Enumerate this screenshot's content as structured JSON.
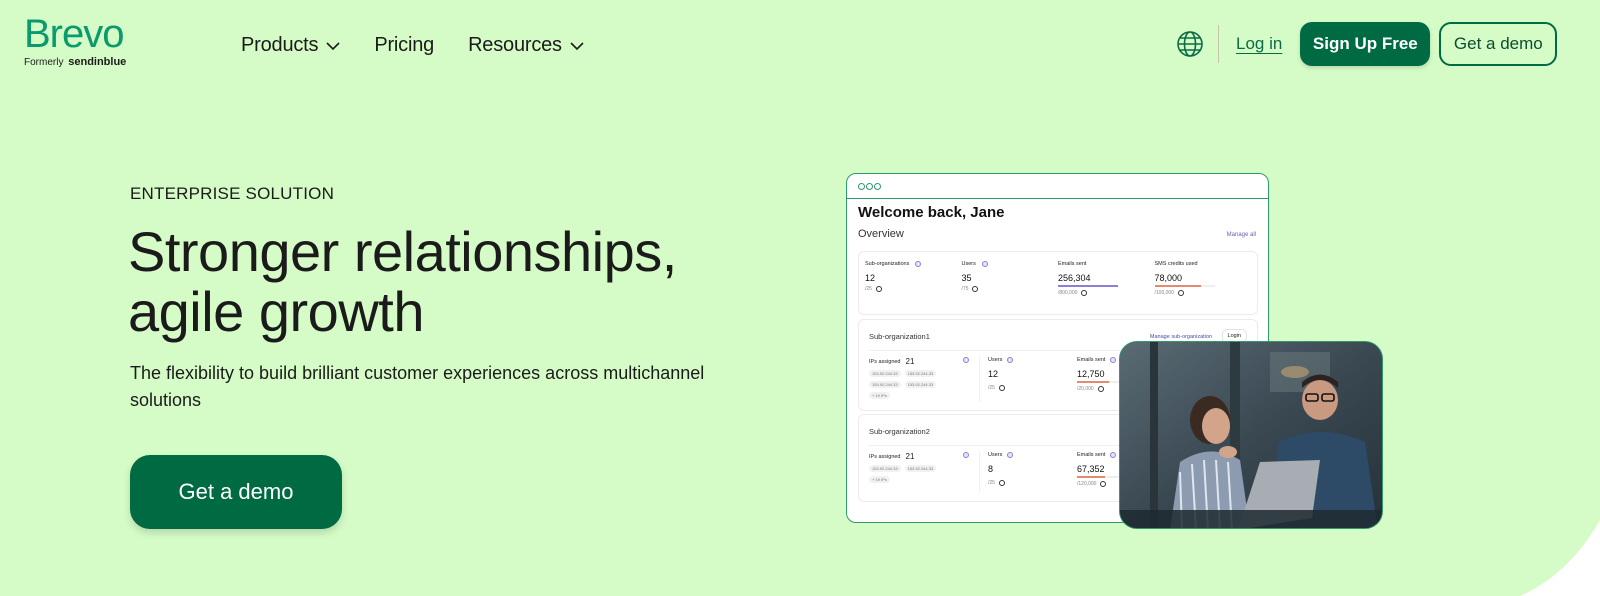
{
  "nav": {
    "logo": {
      "brand": "Brevo",
      "formerly": "Formerly",
      "former_name": "sendinblue"
    },
    "links": [
      {
        "label": "Products",
        "has_dropdown": true
      },
      {
        "label": "Pricing",
        "has_dropdown": false
      },
      {
        "label": "Resources",
        "has_dropdown": true
      }
    ],
    "language_icon": "globe-icon",
    "login": "Log in",
    "signup": "Sign Up Free",
    "demo": "Get a demo"
  },
  "hero": {
    "eyebrow": "ENTERPRISE SOLUTION",
    "headline_line1": "Stronger relationships,",
    "headline_line2": "agile growth",
    "subtext": "The flexibility to build brilliant customer experiences across multichannel solutions",
    "cta": "Get a demo"
  },
  "dashboard": {
    "greeting": "Welcome back, Jane",
    "overview_label": "Overview",
    "manage_all": "Manage all",
    "stats": [
      {
        "label": "Sub-organizations",
        "value": "12",
        "limit": "/25",
        "progress": null
      },
      {
        "label": "Users",
        "value": "35",
        "limit": "/75",
        "progress": null
      },
      {
        "label": "Emails sent",
        "value": "256,304",
        "limit": "/800,000",
        "progress": 1.0,
        "color": "#8b80d3"
      },
      {
        "label": "SMS credits used",
        "value": "78,000",
        "limit": "/100,000",
        "progress": 0.78,
        "color": "#e58b6d"
      }
    ],
    "sub_orgs": [
      {
        "name": "Sub-organization1",
        "manage": "Manage sub-organization",
        "login": "Login",
        "ips_label": "IPs assigned",
        "ips_count": "21",
        "ip_chips": [
          "153.92.244.33",
          "153.92.244.33",
          "153.92.244.33",
          "153.92.244.33"
        ],
        "more_ips": "+ 19 IPs",
        "users_label": "Users",
        "users_value": "12",
        "users_limit": "/25",
        "emails_label": "Emails sent",
        "emails_value": "12,750",
        "emails_limit": "/20,000",
        "emails_progress": 0.64
      },
      {
        "name": "Sub-organization2",
        "ips_label": "IPs assigned",
        "ips_count": "21",
        "ip_chips": [
          "153.92.244.33",
          "153.92.244.33"
        ],
        "more_ips": "+ 19 IPs",
        "users_label": "Users",
        "users_value": "8",
        "users_limit": "/25",
        "emails_label": "Emails sent",
        "emails_value": "67,352",
        "emails_limit": "/120,000",
        "emails_progress": 0.56
      }
    ],
    "photo_alt": "Two colleagues smiling at a laptop"
  },
  "colors": {
    "background": "#d5fcc7",
    "brand_green": "#006a43",
    "logo_green": "#0b996e"
  }
}
